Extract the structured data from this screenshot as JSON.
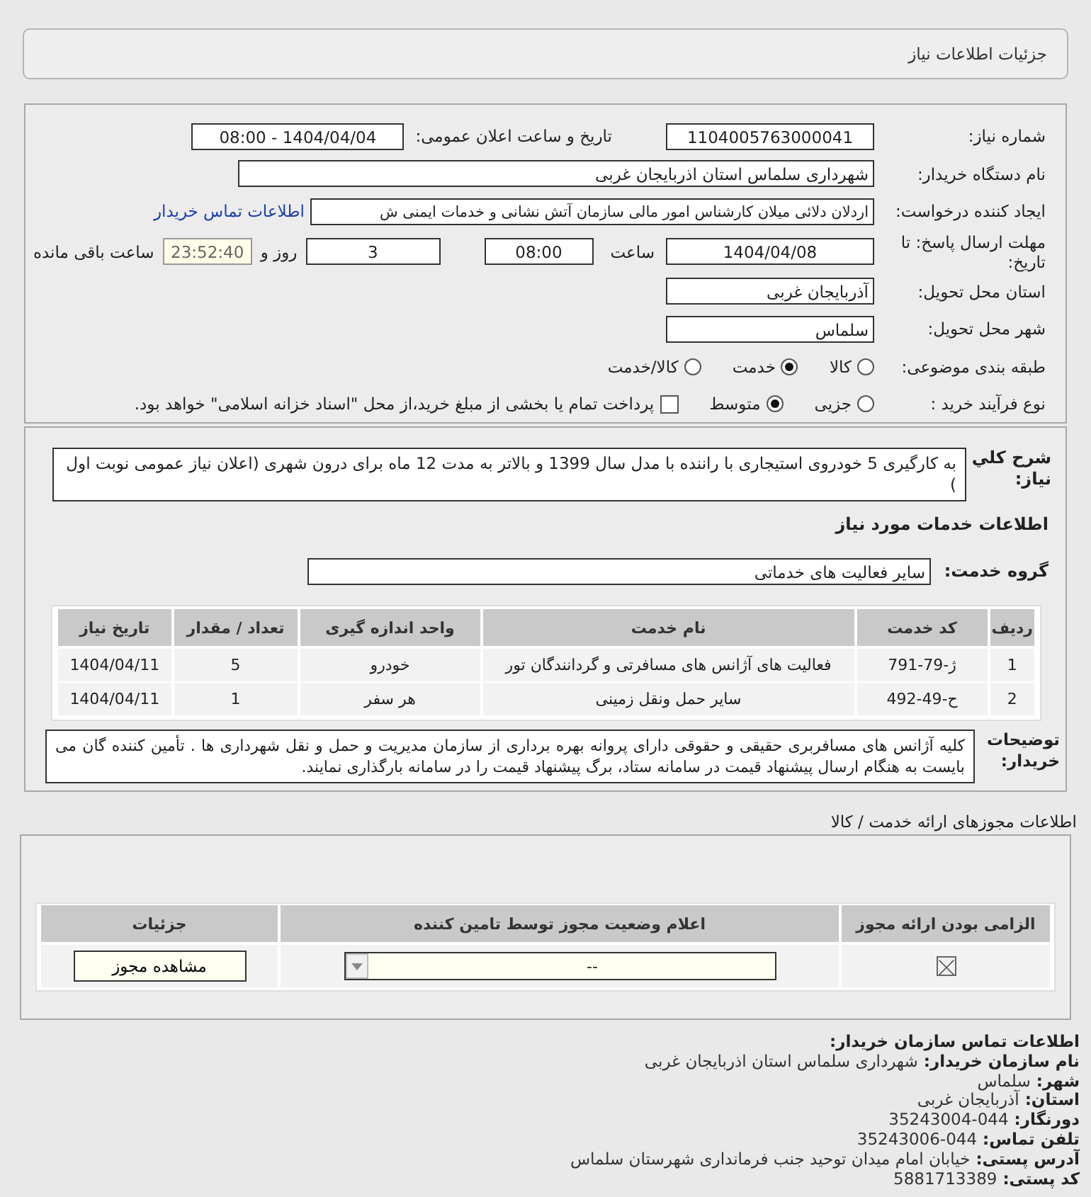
{
  "header": {
    "title": "جزئیات اطلاعات نیاز"
  },
  "form": {
    "need_number": {
      "label": "شماره نیاز:",
      "value": "1104005763000041"
    },
    "announce": {
      "label": "تاریخ و ساعت اعلان عمومی:",
      "value": "1404/04/04 - 08:00"
    },
    "buyer": {
      "label": "نام دستگاه خریدار:",
      "value": "شهرداری سلماس استان اذربایجان غربی"
    },
    "creator": {
      "label": "ایجاد کننده درخواست:",
      "value": "اردلان دلائی میلان کارشناس امور مالی سازمان آتش نشانی و خدمات ایمنی ش",
      "link": "اطلاعات تماس خریدار"
    },
    "deadline": {
      "label": "مهلت ارسال پاسخ: تا تاریخ:",
      "date": "1404/04/08",
      "time_label": "ساعت",
      "time": "08:00",
      "days": "3",
      "days_label": "روز و",
      "remaining": "23:52:40",
      "remaining_label": "ساعت باقی مانده"
    },
    "province": {
      "label": "استان محل تحویل:",
      "value": "آذربایجان غربی"
    },
    "city": {
      "label": "شهر محل تحویل:",
      "value": "سلماس"
    },
    "category": {
      "label": "طبقه بندی موضوعی:",
      "options": [
        {
          "label": "کالا",
          "selected": false
        },
        {
          "label": "خدمت",
          "selected": true
        },
        {
          "label": "کالا/خدمت",
          "selected": false
        }
      ]
    },
    "process": {
      "label": "نوع فرآیند خرید :",
      "options": [
        {
          "label": "جزیی",
          "selected": false
        },
        {
          "label": "متوسط",
          "selected": true
        }
      ],
      "payment": {
        "label": "پرداخت تمام یا بخشی از مبلغ خرید،از محل \"اسناد خزانه اسلامی\" خواهد بود.",
        "checked": false
      }
    }
  },
  "description": {
    "label": "شرح کلي نياز:",
    "text": "به کارگیری 5 خودروی استیجاری با راننده با مدل سال 1399 و بالاتر به مدت 12 ماه برای درون شهری (اعلان نیاز عمومی نوبت اول )"
  },
  "services_title": "اطلاعات خدمات مورد نیاز",
  "service_group": {
    "label": "گروه خدمت:",
    "value": "سایر فعالیت های خدماتی"
  },
  "services_table": {
    "columns": [
      "ردیف",
      "کد خدمت",
      "نام خدمت",
      "واحد اندازه گیری",
      "تعداد / مقدار",
      "تاریخ نیاز"
    ],
    "rows": [
      [
        "1",
        "ژ-79-791",
        "فعالیت های آژانس های مسافرتی و گردانندگان تور",
        "خودرو",
        "5",
        "1404/04/11"
      ],
      [
        "2",
        "ح-49-492",
        "سایر حمل ونقل زمینی",
        "هر سفر",
        "1",
        "1404/04/11"
      ]
    ]
  },
  "buyer_notes": {
    "label": "توضیحات خریدار:",
    "text": "کلیه آژانس های مسافربری حقیقی و حقوقی دارای پروانه بهره برداری از سازمان مدیریت و حمل و نقل شهرداری ها . تأمین کننده گان می بایست به هنگام ارسال پیشنهاد قیمت در سامانه ستاد، برگ پیشنهاد قیمت را در سامانه بارگذاری نمایند."
  },
  "permits": {
    "title": "اطلاعات مجوزهای ارائه خدمت / کالا",
    "columns": [
      "الزامی بودن ارائه مجوز",
      "اعلام وضعیت مجوز توسط تامین کننده",
      "جزئیات"
    ],
    "rows": [
      {
        "required": true,
        "status": "--",
        "action": "مشاهده مجوز"
      }
    ]
  },
  "contact": {
    "title": "اطلاعات تماس سازمان خریدار:",
    "items": [
      {
        "label": "نام سازمان خریدار:",
        "value": "شهرداری سلماس استان اذربایجان غربی"
      },
      {
        "label": "شهر:",
        "value": "سلماس"
      },
      {
        "label": "استان:",
        "value": "آذربایجان غربی"
      },
      {
        "label": "دورنگار:",
        "value": "044-35243004"
      },
      {
        "label": "تلفن تماس:",
        "value": "044-35243006"
      },
      {
        "label": "آدرس پستی:",
        "value": "خیابان امام میدان توحید جنب فرمانداری شهرستان سلماس"
      },
      {
        "label": "کد پستی:",
        "value": "5881713389"
      }
    ]
  }
}
